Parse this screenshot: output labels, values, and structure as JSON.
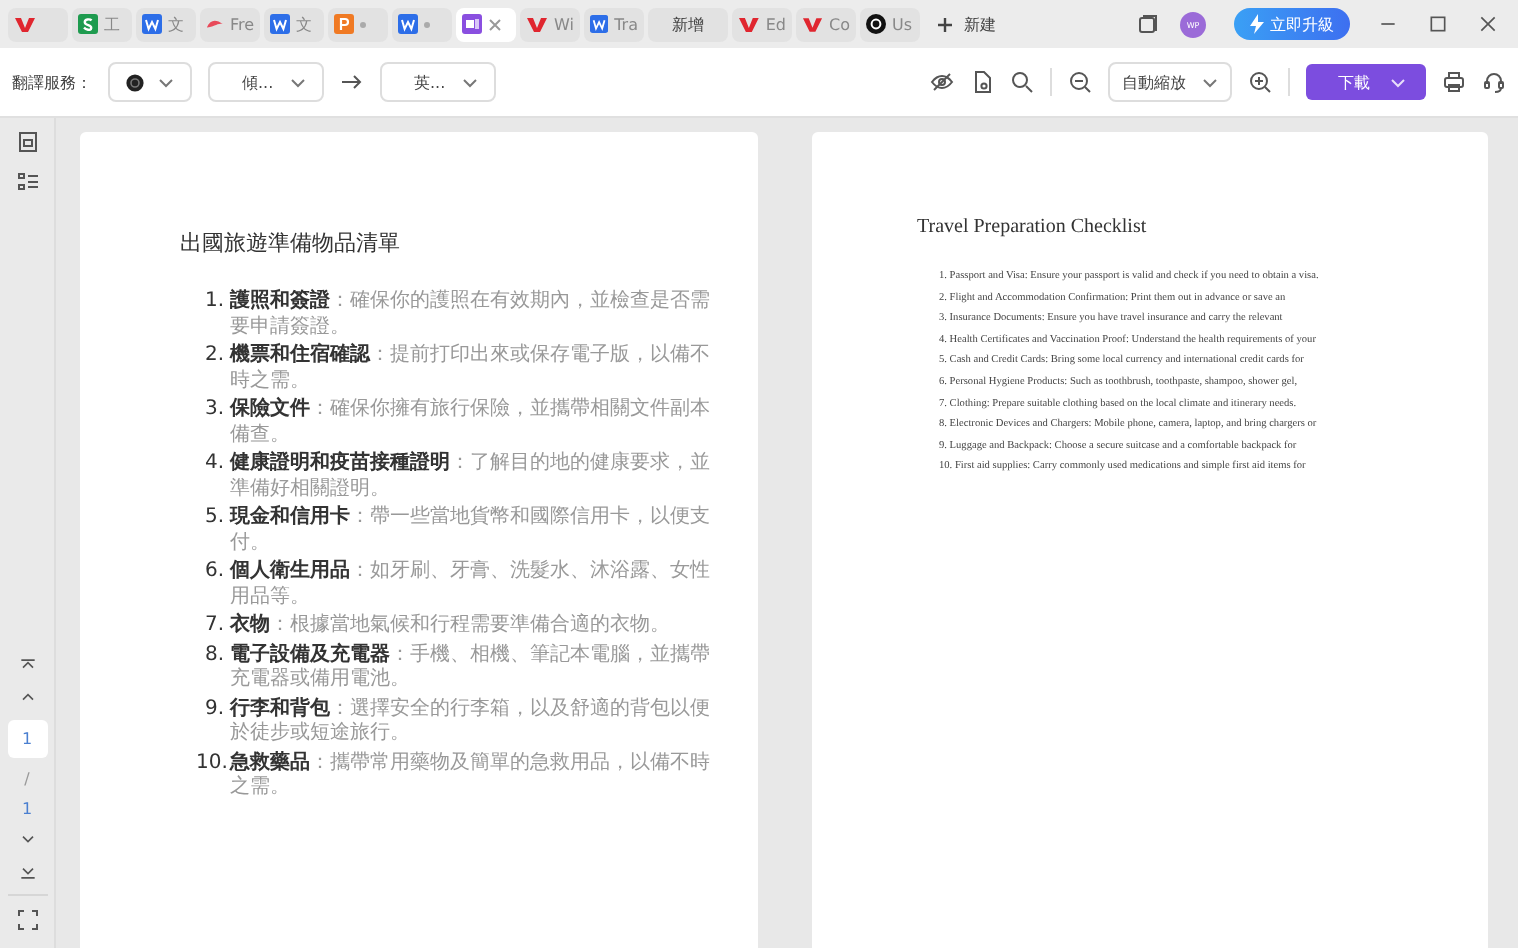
{
  "tabs": [
    {
      "kind": "wps",
      "selected": false
    },
    {
      "kind": "sheet",
      "label": "工",
      "selected": false
    },
    {
      "kind": "writer",
      "label": "文",
      "selected": false
    },
    {
      "kind": "pdf",
      "label": "Fre",
      "selected": false
    },
    {
      "kind": "writer",
      "label": "文",
      "selected": false
    },
    {
      "kind": "slides",
      "selected": false
    },
    {
      "kind": "writer",
      "selected": false
    },
    {
      "kind": "notes",
      "selected": true
    },
    {
      "kind": "wps",
      "label": "Wi",
      "selected": false
    },
    {
      "kind": "writer",
      "label": "Tra",
      "selected": false
    },
    {
      "kind": "text",
      "label": "新增",
      "selected": false
    },
    {
      "kind": "wps",
      "label": "Ed",
      "selected": false
    },
    {
      "kind": "wps",
      "label": "Co",
      "selected": false
    },
    {
      "kind": "circle",
      "label": "Us",
      "selected": false
    }
  ],
  "new_tab": "新建",
  "avatar": "WP",
  "upgrade_button": "立即升級",
  "toolbar": {
    "translate_label": "翻譯服務：",
    "source_language": "傾...",
    "target_language": "英...",
    "zoom": "自動縮放",
    "download": "下載"
  },
  "sidebar": {
    "page_input": "1",
    "separator": "/",
    "page_count": "1"
  },
  "pages": [
    {
      "kind": "numbered",
      "title": "出國旅遊準備物品清單",
      "items": [
        {
          "number": "1.",
          "term": "護照和簽證",
          "text": "：確保你的護照在有效期內，並檢查是否需要申請簽證。"
        },
        {
          "number": "2.",
          "term": "機票和住宿確認",
          "text": "：提前打印出來或保存電子版，以備不時之需。"
        },
        {
          "number": "3.",
          "term": "保險文件",
          "text": "：確保你擁有旅行保險，並攜帶相關文件副本備查。"
        },
        {
          "number": "4.",
          "term": "健康證明和疫苗接種證明",
          "text": "：了解目的地的健康要求，並準備好相關證明。"
        },
        {
          "number": "5.",
          "term": "現金和信用卡",
          "text": "：帶一些當地貨幣和國際信用卡，以便支付。"
        },
        {
          "number": "6.",
          "term": "個人衛生用品",
          "text": "：如牙刷、牙膏、洗髮水、沐浴露、女性用品等。"
        },
        {
          "number": "7.",
          "term": "衣物",
          "text": "：根據當地氣候和行程需要準備合適的衣物。"
        },
        {
          "number": "8.",
          "term": "電子設備及充電器",
          "text": "：手機、相機、筆記本電腦，並攜帶充電器或備用電池。"
        },
        {
          "number": "9.",
          "term": "行李和背包",
          "text": "：選擇安全的行李箱，以及舒適的背包以便於徒步或短途旅行。"
        },
        {
          "number": "10.",
          "term": "急救藥品",
          "text": "：攜帶常用藥物及簡單的急救用品，以備不時之需。"
        }
      ]
    },
    {
      "kind": "plain",
      "title": "Travel Preparation Checklist",
      "lines": [
        "1. Passport and Visa: Ensure your passport is valid and check if you need to obtain a visa.",
        "2. Flight and Accommodation Confirmation: Print them out in advance or save an",
        "3. Insurance Documents: Ensure you have travel insurance and carry the relevant",
        "4. Health Certificates and Vaccination Proof: Understand the health requirements of your",
        "5. Cash and Credit Cards: Bring some local currency and international credit cards for",
        "6. Personal Hygiene Products: Such as toothbrush, toothpaste, shampoo, shower gel,",
        "7. Clothing: Prepare suitable clothing based on the local climate and itinerary needs.",
        "8. Electronic Devices and Chargers: Mobile phone, camera, laptop, and bring chargers or",
        "9. Luggage and Backpack: Choose a secure suitcase and a comfortable backpack for",
        "10. First aid supplies: Carry commonly used medications and simple first aid items for"
      ]
    }
  ]
}
